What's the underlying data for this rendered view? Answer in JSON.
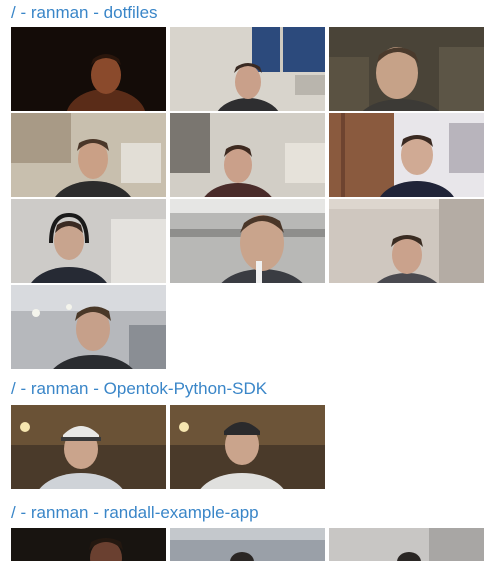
{
  "sections": [
    {
      "root": "/",
      "separator": "-",
      "user": "ranman",
      "repo": "dotfiles",
      "thumbnails": [
        {
          "label": "webcam-photo",
          "scene": "dark-room"
        },
        {
          "label": "webcam-photo",
          "scene": "window-office"
        },
        {
          "label": "webcam-photo",
          "scene": "couch"
        },
        {
          "label": "webcam-photo",
          "scene": "office"
        },
        {
          "label": "webcam-photo",
          "scene": "office"
        },
        {
          "label": "webcam-photo",
          "scene": "curtain-window"
        },
        {
          "label": "webcam-photo",
          "scene": "office-headphones"
        },
        {
          "label": "webcam-photo",
          "scene": "open-office-closeup"
        },
        {
          "label": "webcam-photo",
          "scene": "plain-wall"
        },
        {
          "label": "webcam-photo",
          "scene": "office-lights"
        }
      ]
    },
    {
      "root": "/",
      "separator": "-",
      "user": "ranman",
      "repo": "Opentok-Python-SDK",
      "thumbnails": [
        {
          "label": "webcam-photo",
          "scene": "hall-cap"
        },
        {
          "label": "webcam-photo",
          "scene": "hall"
        }
      ]
    },
    {
      "root": "/",
      "separator": "-",
      "user": "ranman",
      "repo": "randall-example-app",
      "thumbnails": [
        {
          "label": "webcam-photo",
          "scene": "dark-partial"
        },
        {
          "label": "webcam-photo",
          "scene": "partial"
        },
        {
          "label": "webcam-photo",
          "scene": "partial"
        }
      ]
    }
  ],
  "colors": {
    "link": "#3a86c8"
  }
}
